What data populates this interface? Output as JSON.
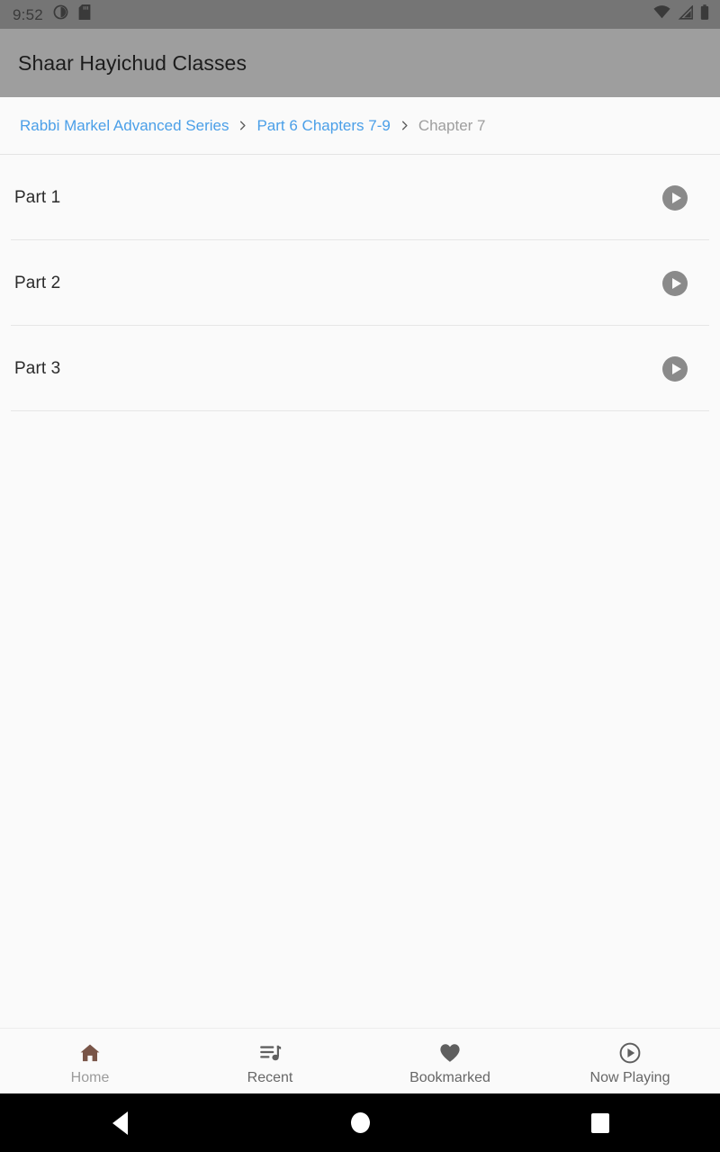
{
  "status_bar": {
    "time": "9:52",
    "icons_left": [
      "contrast-circle-icon",
      "sd-card-icon"
    ],
    "icons_right": [
      "wifi-icon",
      "cell-signal-icon",
      "battery-icon"
    ],
    "background": "#757575"
  },
  "app_bar": {
    "title": "Shaar Hayichud Classes",
    "background": "#9e9e9e"
  },
  "breadcrumb": {
    "separator": "chevron-right-icon",
    "link_color": "#4a9fe8",
    "current_color": "#9e9e9e",
    "items": [
      {
        "label": "Rabbi Markel Advanced Series",
        "current": false
      },
      {
        "label": "Part 6 Chapters 7-9",
        "current": false
      },
      {
        "label": "Chapter 7",
        "current": true
      }
    ]
  },
  "list": {
    "rows": [
      {
        "title": "Part 1",
        "action_icon": "play-circle-icon"
      },
      {
        "title": "Part 2",
        "action_icon": "play-circle-icon"
      },
      {
        "title": "Part 3",
        "action_icon": "play-circle-icon"
      }
    ]
  },
  "bottom_nav": {
    "active_index": 0,
    "active_color": "#795548",
    "inactive_color": "#676767",
    "items": [
      {
        "label": "Home",
        "icon": "home-icon"
      },
      {
        "label": "Recent",
        "icon": "queue-music-icon"
      },
      {
        "label": "Bookmarked",
        "icon": "heart-icon"
      },
      {
        "label": "Now Playing",
        "icon": "play-circle-outline-icon"
      }
    ]
  },
  "system_nav": {
    "buttons": [
      {
        "name": "back",
        "icon": "triangle-back-icon"
      },
      {
        "name": "home",
        "icon": "circle-home-icon"
      },
      {
        "name": "recents",
        "icon": "square-recents-icon"
      }
    ]
  }
}
